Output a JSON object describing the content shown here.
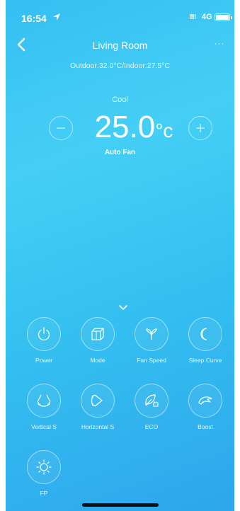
{
  "status": {
    "time": "16:54",
    "signal": "!!!!",
    "network": "4G"
  },
  "header": {
    "title": "Living Room",
    "more": "···",
    "temperatures": "Outdoor:32.0°C/Indoor:27.5°C"
  },
  "control": {
    "mode": "Cool",
    "temperature": "25.0",
    "unit": "°c",
    "fan": "Auto Fan"
  },
  "functions": [
    {
      "label": "Power",
      "icon": "power-icon"
    },
    {
      "label": "Mode",
      "icon": "mode-icon"
    },
    {
      "label": "Fan Speed",
      "icon": "fan-icon"
    },
    {
      "label": "Sleep Curve",
      "icon": "moon-icon"
    },
    {
      "label": "Vertical S",
      "icon": "vertical-swing-icon"
    },
    {
      "label": "Horizontal S",
      "icon": "horizontal-swing-icon"
    },
    {
      "label": "ECO",
      "icon": "eco-leaf-icon"
    },
    {
      "label": "Boost",
      "icon": "boost-icon"
    },
    {
      "label": "FP",
      "icon": "sun-icon"
    }
  ]
}
